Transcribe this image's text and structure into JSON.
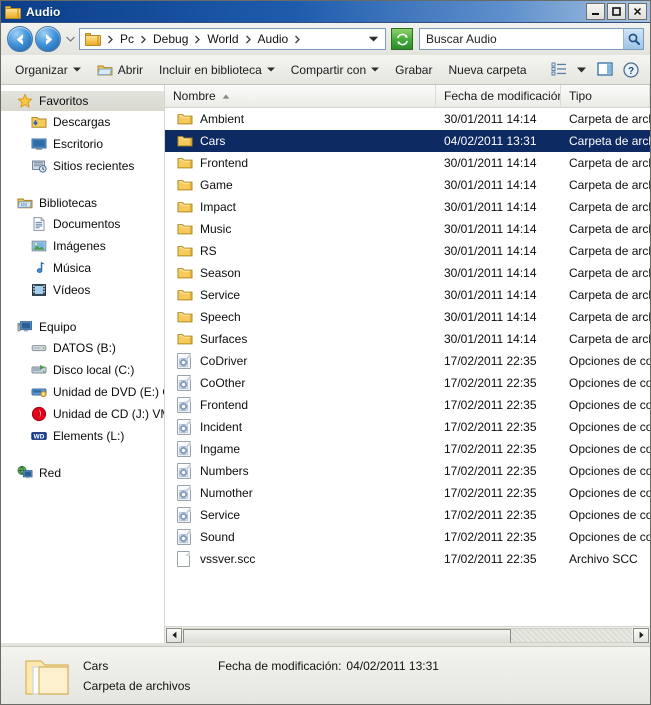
{
  "window": {
    "title": "Audio",
    "icon": "folder-icon",
    "buttons": {
      "minimize": "minimize-icon",
      "maximize": "maximize-icon",
      "close": "close-icon"
    }
  },
  "navbar": {
    "back": "back-arrow-icon",
    "forward": "forward-arrow-icon",
    "history_dropdown": "chevron-down-icon",
    "breadcrumbs": [
      "Pc",
      "Debug",
      "World",
      "Audio"
    ],
    "address_dropdown": "chevron-down-icon",
    "refresh": "refresh-icon",
    "search": {
      "placeholder": "Buscar Audio",
      "icon": "search-icon"
    }
  },
  "toolbar": {
    "organize": "Organizar",
    "open": "Abrir",
    "include_library": "Incluir en biblioteca",
    "share_with": "Compartir con",
    "burn": "Grabar",
    "new_folder": "Nueva carpeta",
    "view_icon": "view-list-icon",
    "view_dropdown": "chevron-down-icon",
    "preview_pane_icon": "preview-pane-icon",
    "help_icon": "help-icon"
  },
  "sidebar": {
    "groups": [
      {
        "header": "Favoritos",
        "header_icon": "star-icon",
        "selected": true,
        "items": [
          {
            "label": "Descargas",
            "icon": "downloads-folder-icon"
          },
          {
            "label": "Escritorio",
            "icon": "desktop-icon"
          },
          {
            "label": "Sitios recientes",
            "icon": "recent-places-icon"
          }
        ]
      },
      {
        "header": "Bibliotecas",
        "header_icon": "libraries-icon",
        "selected": false,
        "items": [
          {
            "label": "Documentos",
            "icon": "documents-icon"
          },
          {
            "label": "Imágenes",
            "icon": "pictures-icon"
          },
          {
            "label": "Música",
            "icon": "music-icon"
          },
          {
            "label": "Vídeos",
            "icon": "videos-icon"
          }
        ]
      },
      {
        "header": "Equipo",
        "header_icon": "computer-icon",
        "selected": false,
        "items": [
          {
            "label": "DATOS (B:)",
            "icon": "floppy-drive-icon"
          },
          {
            "label": "Disco local (C:)",
            "icon": "hard-drive-icon"
          },
          {
            "label": "Unidad de DVD (E:) OF",
            "icon": "dvd-drive-icon"
          },
          {
            "label": "Unidad de CD (J:) VMC",
            "icon": "cd-drive-icon"
          },
          {
            "label": "Elements (L:)",
            "icon": "external-drive-icon"
          }
        ]
      },
      {
        "header": "Red",
        "header_icon": "network-icon",
        "selected": false,
        "items": []
      }
    ]
  },
  "filelist": {
    "columns": [
      {
        "key": "name",
        "label": "Nombre",
        "sorted": true,
        "sort_dir": "asc",
        "sort_glyph": "▲"
      },
      {
        "key": "date",
        "label": "Fecha de modificación",
        "sorted": false
      },
      {
        "key": "type",
        "label": "Tipo",
        "sorted": false
      }
    ],
    "rows": [
      {
        "name": "Ambient",
        "date": "30/01/2011 14:14",
        "type": "Carpeta de archivo",
        "icon": "folder-icon",
        "selected": false
      },
      {
        "name": "Cars",
        "date": "04/02/2011 13:31",
        "type": "Carpeta de archivo",
        "icon": "folder-icon",
        "selected": true
      },
      {
        "name": "Frontend",
        "date": "30/01/2011 14:14",
        "type": "Carpeta de archivo",
        "icon": "folder-icon",
        "selected": false
      },
      {
        "name": "Game",
        "date": "30/01/2011 14:14",
        "type": "Carpeta de archivo",
        "icon": "folder-icon",
        "selected": false
      },
      {
        "name": "Impact",
        "date": "30/01/2011 14:14",
        "type": "Carpeta de archivo",
        "icon": "folder-icon",
        "selected": false
      },
      {
        "name": "Music",
        "date": "30/01/2011 14:14",
        "type": "Carpeta de archivo",
        "icon": "folder-icon",
        "selected": false
      },
      {
        "name": "RS",
        "date": "30/01/2011 14:14",
        "type": "Carpeta de archivo",
        "icon": "folder-icon",
        "selected": false
      },
      {
        "name": "Season",
        "date": "30/01/2011 14:14",
        "type": "Carpeta de archivo",
        "icon": "folder-icon",
        "selected": false
      },
      {
        "name": "Service",
        "date": "30/01/2011 14:14",
        "type": "Carpeta de archivo",
        "icon": "folder-icon",
        "selected": false
      },
      {
        "name": "Speech",
        "date": "30/01/2011 14:14",
        "type": "Carpeta de archivo",
        "icon": "folder-icon",
        "selected": false
      },
      {
        "name": "Surfaces",
        "date": "30/01/2011 14:14",
        "type": "Carpeta de archivo",
        "icon": "folder-icon",
        "selected": false
      },
      {
        "name": "CoDriver",
        "date": "17/02/2011 22:35",
        "type": "Opciones de config",
        "icon": "config-file-icon",
        "selected": false
      },
      {
        "name": "CoOther",
        "date": "17/02/2011 22:35",
        "type": "Opciones de config",
        "icon": "config-file-icon",
        "selected": false
      },
      {
        "name": "Frontend",
        "date": "17/02/2011 22:35",
        "type": "Opciones de config",
        "icon": "config-file-icon",
        "selected": false
      },
      {
        "name": "Incident",
        "date": "17/02/2011 22:35",
        "type": "Opciones de config",
        "icon": "config-file-icon",
        "selected": false
      },
      {
        "name": "Ingame",
        "date": "17/02/2011 22:35",
        "type": "Opciones de config",
        "icon": "config-file-icon",
        "selected": false
      },
      {
        "name": "Numbers",
        "date": "17/02/2011 22:35",
        "type": "Opciones de config",
        "icon": "config-file-icon",
        "selected": false
      },
      {
        "name": "Numother",
        "date": "17/02/2011 22:35",
        "type": "Opciones de config",
        "icon": "config-file-icon",
        "selected": false
      },
      {
        "name": "Service",
        "date": "17/02/2011 22:35",
        "type": "Opciones de config",
        "icon": "config-file-icon",
        "selected": false
      },
      {
        "name": "Sound",
        "date": "17/02/2011 22:35",
        "type": "Opciones de config",
        "icon": "config-file-icon",
        "selected": false
      },
      {
        "name": "vssver.scc",
        "date": "17/02/2011 22:35",
        "type": "Archivo SCC",
        "icon": "plain-file-icon",
        "selected": false
      }
    ]
  },
  "scrollbar": {
    "left_arrow": "scroll-left-icon",
    "right_arrow": "scroll-right-icon"
  },
  "details": {
    "icon": "folder-icon",
    "name": "Cars",
    "type": "Carpeta de archivos",
    "date_label": "Fecha de modificación:",
    "date_value": "04/02/2011 13:31"
  },
  "colors": {
    "title_bar_start": "#0b3e88",
    "selection": "#0d2a63",
    "folder_yellow": "#f6cb5c",
    "refresh_green": "#43a83a"
  }
}
